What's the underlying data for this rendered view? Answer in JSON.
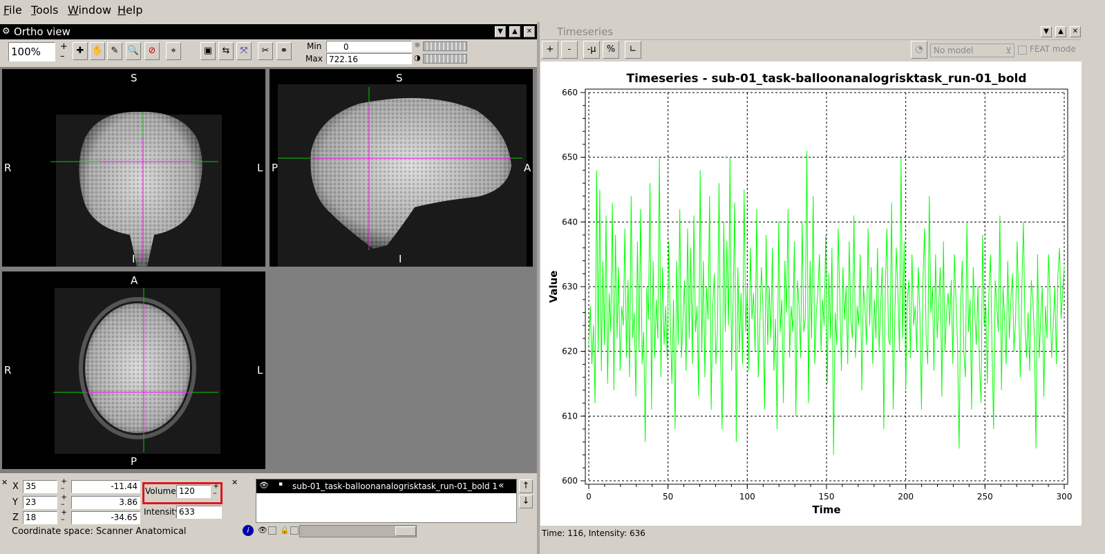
{
  "menubar": {
    "items": [
      "File",
      "Tools",
      "Window",
      "Help"
    ]
  },
  "ortho": {
    "title": "Ortho view",
    "zoom": "100%",
    "min_label": "Min",
    "max_label": "Max",
    "min_value": "0",
    "max_value": "722.16",
    "coronal": {
      "top": "S",
      "bottom": "I",
      "left": "R",
      "right": "L"
    },
    "sagittal": {
      "top": "S",
      "bottom": "I",
      "left": "P",
      "right": "A"
    },
    "axial": {
      "top": "A",
      "bottom": "P",
      "left": "R",
      "right": "L"
    }
  },
  "location": {
    "x_label": "X",
    "y_label": "Y",
    "z_label": "Z",
    "x_voxel": "35",
    "y_voxel": "23",
    "z_voxel": "18",
    "x_world": "-11.44",
    "y_world": "3.86",
    "z_world": "-34.65",
    "volume_label": "Volume",
    "volume_value": "120",
    "intensity_label": "Intensity",
    "intensity_value": "633",
    "coord_space": "Coordinate space: Scanner Anatomical"
  },
  "overlay_list": {
    "item": "sub-01_task-balloonanalogrisktask_run-01_bold 1"
  },
  "timeseries": {
    "window_title": "Timeseries",
    "btn_plus": "+",
    "btn_minus": "-",
    "btn_mu": "-μ",
    "btn_pct": "%",
    "model": "No model",
    "feat_mode": "FEAT mode",
    "status": "Time: 116, Intensity: 636"
  },
  "chart_data": {
    "type": "line",
    "title": "Timeseries - sub-01_task-balloonanalogrisktask_run-01_bold",
    "xlabel": "Time",
    "ylabel": "Value",
    "xlim": [
      0,
      300
    ],
    "ylim": [
      600,
      660
    ],
    "xticks": [
      0,
      50,
      100,
      150,
      200,
      250,
      300
    ],
    "yticks": [
      600,
      610,
      620,
      630,
      640,
      650,
      660
    ],
    "grid": true,
    "color": "#00ff00",
    "series": [
      {
        "values": [
          621,
          627,
          618,
          624,
          612,
          648,
          620,
          645,
          617,
          634,
          621,
          641,
          615,
          629,
          623,
          643,
          614,
          638,
          622,
          633,
          617,
          627,
          624,
          639,
          619,
          631,
          616,
          644,
          622,
          626,
          613,
          637,
          620,
          642,
          618,
          623,
          606,
          630,
          625,
          646,
          611,
          634,
          619,
          628,
          622,
          650,
          616,
          633,
          621,
          627,
          619,
          637,
          624,
          615,
          628,
          608,
          634,
          621,
          642,
          619,
          625,
          631,
          617,
          639,
          622,
          636,
          618,
          641,
          623,
          627,
          613,
          648,
          620,
          634,
          616,
          630,
          625,
          644,
          611,
          627,
          632,
          618,
          623,
          646,
          619,
          608,
          640,
          623,
          637,
          624,
          650,
          617,
          628,
          643,
          606,
          633,
          620,
          629,
          618,
          645,
          623,
          630,
          617,
          636,
          625,
          629,
          620,
          642,
          616,
          624,
          633,
          627,
          611,
          638,
          621,
          630,
          622,
          636,
          617,
          625,
          608,
          640,
          623,
          628,
          612,
          634,
          626,
          642,
          619,
          627,
          623,
          637,
          610,
          631,
          627,
          619,
          640,
          623,
          625,
          651,
          612,
          634,
          622,
          644,
          618,
          626,
          629,
          635,
          620,
          628,
          624,
          638,
          615,
          632,
          622,
          636,
          604,
          626,
          621,
          639,
          628,
          617,
          633,
          625,
          630,
          618,
          637,
          625,
          622,
          641,
          619,
          627,
          624,
          635,
          614,
          630,
          627,
          621,
          639,
          624,
          633,
          618,
          628,
          622,
          636,
          620,
          627,
          633,
          608,
          630,
          639,
          622,
          621,
          643,
          611,
          625,
          636,
          629,
          620,
          650,
          622,
          637,
          614,
          628,
          631,
          619,
          635,
          624,
          627,
          620,
          633,
          626,
          611,
          631,
          639,
          622,
          618,
          644,
          626,
          630,
          617,
          635,
          622,
          627,
          633,
          613,
          637,
          620,
          626,
          629,
          624,
          631,
          618,
          635,
          628,
          621,
          605,
          627,
          634,
          620,
          616,
          640,
          623,
          628,
          611,
          633,
          626,
          621,
          630,
          618,
          612,
          638,
          624,
          627,
          615,
          629,
          635,
          620,
          608,
          631,
          627,
          623,
          641,
          614,
          630,
          625,
          618,
          634,
          622,
          628,
          632,
          620,
          625,
          637,
          627,
          616,
          630,
          640,
          624,
          619,
          626,
          617,
          631,
          628,
          622,
          605,
          635,
          619,
          625,
          630,
          613,
          627,
          622,
          635,
          628,
          619,
          624,
          630,
          618,
          632,
          636,
          625,
          629,
          633
        ]
      }
    ]
  }
}
